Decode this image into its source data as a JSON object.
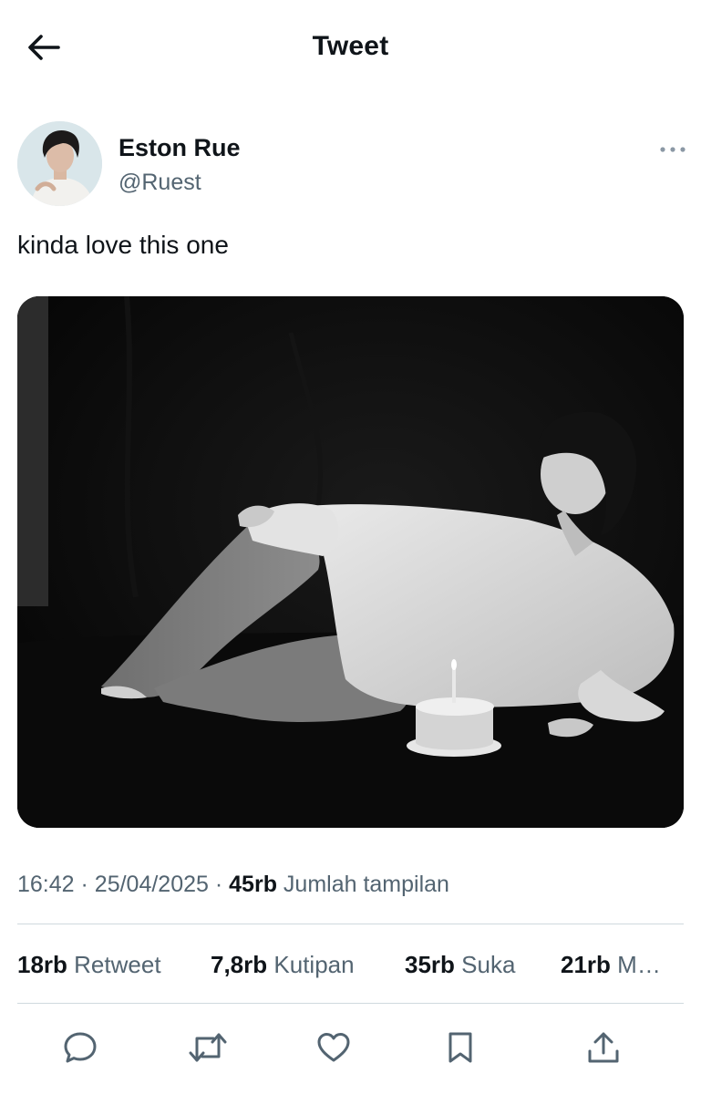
{
  "header": {
    "title": "Tweet",
    "back_icon": "arrow-left-icon"
  },
  "author": {
    "display_name": "Eston Rue",
    "handle": "@Ruest"
  },
  "tweet": {
    "text": "kinda love this one"
  },
  "meta": {
    "time": "16:42",
    "separator": "·",
    "date": "25/04/2025",
    "views_count": "45rb",
    "views_label": "Jumlah tampilan"
  },
  "stats": {
    "retweets_count": "18rb",
    "retweets_label": "Retweet",
    "quotes_count": "7,8rb",
    "quotes_label": "Kutipan",
    "likes_count": "35rb",
    "likes_label": "Suka",
    "bookmarks_count": "21rb",
    "bookmarks_label": "M…"
  },
  "actions": [
    "reply-icon",
    "retweet-icon",
    "like-icon",
    "bookmark-icon",
    "share-icon"
  ],
  "colors": {
    "text": "#0f1419",
    "secondary": "#536471",
    "divider": "#cfd9de",
    "background": "#ffffff"
  }
}
